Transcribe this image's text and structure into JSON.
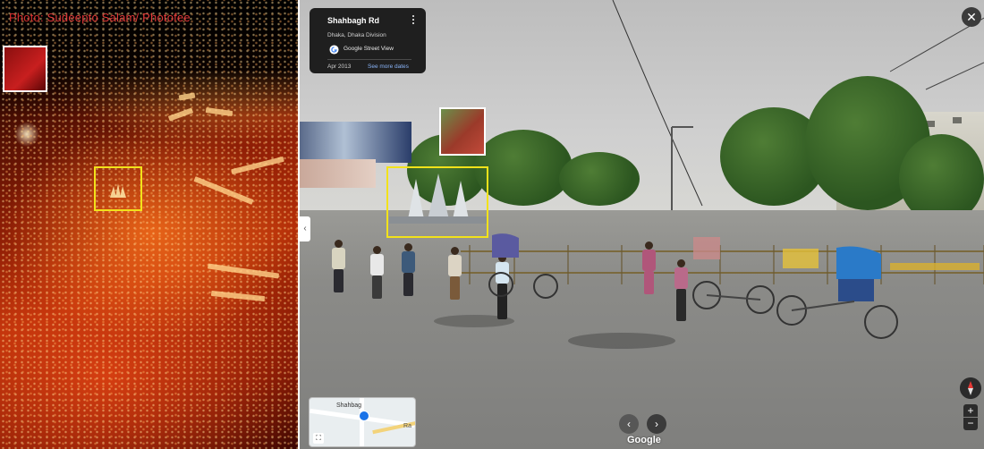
{
  "left_photo": {
    "credit_prefix": "Photo: ",
    "credit_name": "Sudeepto Salam/ Photofee"
  },
  "streetview": {
    "info_card": {
      "title": "Shahbagh Rd",
      "subtitle": "Dhaka, Dhaka Division",
      "source_label": "Google Street View",
      "date": "Apr 2013",
      "more_dates_label": "See more dates"
    },
    "close_label": "✕",
    "minimap": {
      "label": "Shahbag",
      "edge_label": "Ra"
    },
    "nav": {
      "prev": "‹",
      "next": "›"
    },
    "brand": "Google",
    "zoom": {
      "in": "+",
      "out": "−"
    }
  },
  "colors": {
    "highlight_yellow": "#f2e21a",
    "highlight_white": "#ffffff",
    "credit_red": "#d93030",
    "link_blue": "#8ab4f8"
  },
  "icons": [
    "more-vert-icon",
    "google-logo-icon",
    "close-icon",
    "chevron-left-icon",
    "chevron-right-icon",
    "compass-icon",
    "expand-icon",
    "map-pin-icon"
  ]
}
